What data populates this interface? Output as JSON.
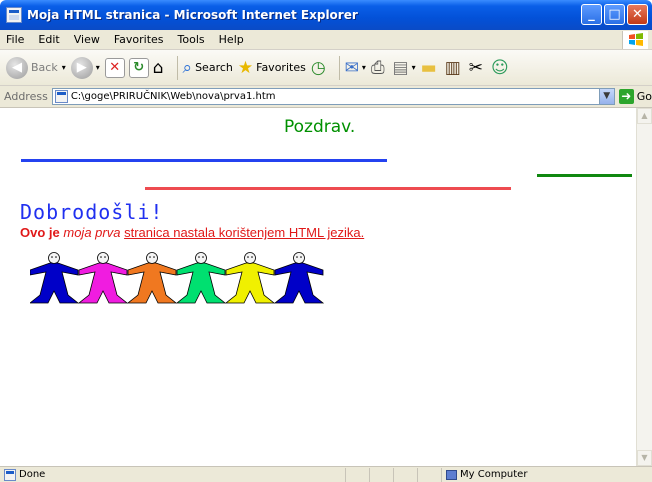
{
  "window": {
    "title": "Moja HTML stranica - Microsoft Internet Explorer"
  },
  "menu": [
    "File",
    "Edit",
    "View",
    "Favorites",
    "Tools",
    "Help"
  ],
  "toolbar": {
    "back": "Back",
    "search": "Search",
    "favorites": "Favorites"
  },
  "address": {
    "label": "Address",
    "value": "C:\\goge\\PRIRUČNIK\\Web\\nova\\prva1.htm",
    "go": "Go"
  },
  "page": {
    "greeting": "Pozdrav.",
    "welcome": "Dobrodošli!",
    "subtitle_bold": "Ovo je",
    "subtitle_italic": "moja prva",
    "subtitle_underline": "stranica nastala korištenjem HTML jezika.",
    "people_colors": [
      "#0000c8",
      "#f01ce0",
      "#f07820",
      "#00e070",
      "#f0f000",
      "#0000c8"
    ]
  },
  "status": {
    "text": "Done",
    "zone": "My Computer"
  },
  "colors": {
    "greeting": "#009000",
    "rule_blue": "#2442f0",
    "rule_red": "#ee4b50",
    "rule_green": "#108810",
    "welcome": "#2030f0",
    "subtitle": "#e01818"
  }
}
